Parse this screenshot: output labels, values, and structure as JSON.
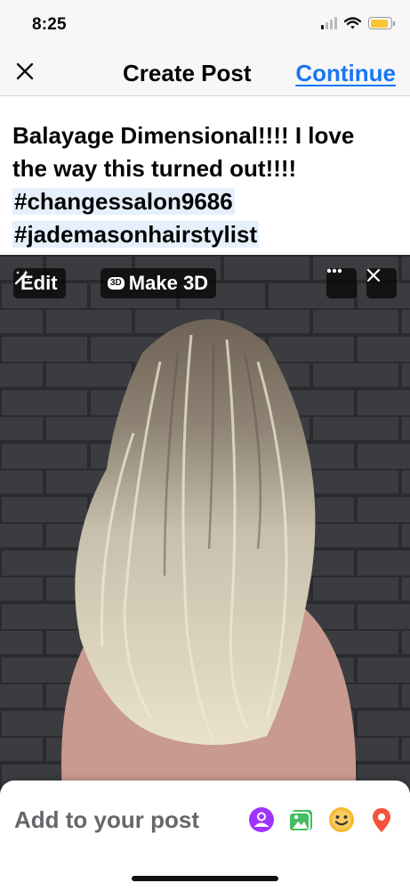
{
  "status_bar": {
    "time": "8:25",
    "battery_level": 0.9
  },
  "header": {
    "close_icon": "close-icon",
    "title": "Create Post",
    "continue_label": "Continue"
  },
  "post": {
    "caption": "Balayage Dimensional!!!! I love the way this turned out!!!!",
    "hashtags": [
      "#changessalon9686",
      "#jademasonhairstylist"
    ]
  },
  "photo": {
    "edit_label": "Edit",
    "edit_icon": "magic-wand-icon",
    "make3d_badge": "3D",
    "make3d_label": "Make 3D",
    "more_icon": "more-icon",
    "remove_icon": "close-icon"
  },
  "add_to_post": {
    "label": "Add to your post",
    "icons": [
      "tag-people-icon",
      "photo-video-icon",
      "feeling-icon",
      "location-icon"
    ]
  },
  "colors": {
    "accent": "#1877f2",
    "hashtag_background": "#e6f0fd",
    "tag_people": "#a033ff",
    "photo": "#45bd62",
    "feeling": "#f7b928",
    "location": "#f5533d"
  }
}
